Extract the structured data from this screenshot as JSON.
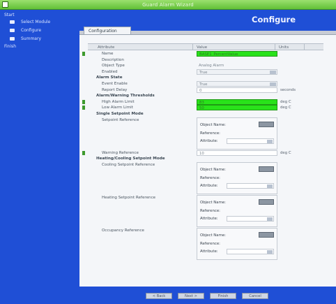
{
  "window": {
    "title": "Guard Alarm Wizard"
  },
  "sidebar": {
    "heading": "Start",
    "items": [
      {
        "label": "Select Module"
      },
      {
        "label": "Configure"
      },
      {
        "label": "Summary"
      }
    ],
    "sub": "Finish"
  },
  "header": {
    "title": "Configure"
  },
  "tabs": [
    {
      "label": "Configuration"
    }
  ],
  "grid": {
    "columns": [
      "Attribute",
      "Value",
      "Units"
    ]
  },
  "rows": [
    {
      "type": "field",
      "label": "Name",
      "value": "BASE1_PercentValue",
      "value_style": "green",
      "marked": true,
      "unit": ""
    },
    {
      "type": "field",
      "label": "Description",
      "value": "",
      "value_style": "none",
      "marked": false,
      "unit": ""
    },
    {
      "type": "field",
      "label": "Object Type",
      "value": "Analog Alarm",
      "value_style": "none",
      "marked": false,
      "unit": ""
    },
    {
      "type": "field",
      "label": "Enabled",
      "value": "True",
      "value_style": "select",
      "marked": false,
      "unit": ""
    },
    {
      "type": "section",
      "label": "Alarm State"
    },
    {
      "type": "field",
      "label": "Event Enable",
      "value": "True",
      "value_style": "select",
      "marked": false,
      "unit": ""
    },
    {
      "type": "field",
      "label": "Report Delay",
      "value": "0",
      "value_style": "field",
      "marked": false,
      "unit": "seconds"
    },
    {
      "type": "section",
      "label": "Alarm/Warning Thresholds"
    },
    {
      "type": "field",
      "label": "High Alarm Limit",
      "value": "83",
      "value_style": "green",
      "marked": true,
      "unit": "deg C"
    },
    {
      "type": "field",
      "label": "Low Alarm Limit",
      "value": "50",
      "value_style": "green",
      "marked": true,
      "unit": "deg C"
    },
    {
      "type": "section",
      "label": "Single Setpoint Mode"
    },
    {
      "type": "ref",
      "label": "Setpoint Reference",
      "object_name_label": "Object Name:",
      "reference_label": "Reference:",
      "attribute_label": "Attribute:"
    },
    {
      "type": "field",
      "label": "Warning Reference",
      "value": "10",
      "value_style": "field",
      "marked": true,
      "unit": "deg C"
    },
    {
      "type": "section",
      "label": "Heating/Cooling Setpoint Mode"
    },
    {
      "type": "ref",
      "label": "Cooling Setpoint Reference",
      "object_name_label": "Object Name:",
      "reference_label": "Reference:",
      "attribute_label": "Attribute:"
    },
    {
      "type": "ref",
      "label": "Heating Setpoint Reference",
      "object_name_label": "Object Name:",
      "reference_label": "Reference:",
      "attribute_label": "Attribute:"
    },
    {
      "type": "ref",
      "label": "Occupancy Reference",
      "object_name_label": "Object Name:",
      "reference_label": "Reference:",
      "attribute_label": "Attribute:"
    }
  ],
  "footer": {
    "buttons": [
      "< Back",
      "Next >",
      "Finish",
      "Cancel"
    ]
  },
  "colors": {
    "brand_blue": "#1f4fd6",
    "titlebar_green": "#62c038",
    "value_highlight": "#29e21a"
  }
}
